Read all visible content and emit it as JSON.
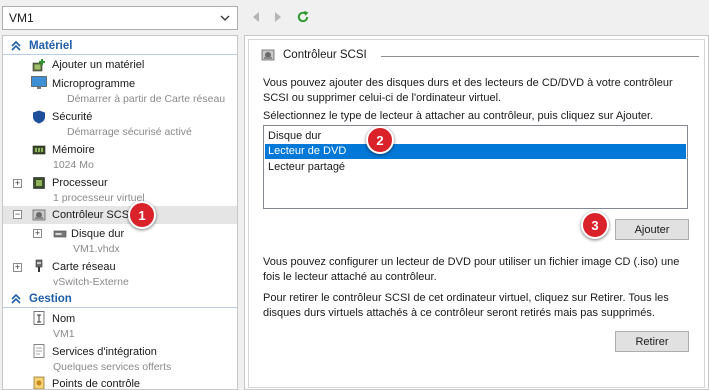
{
  "vm_selector": {
    "value": "VM1"
  },
  "sidebar": {
    "sections": {
      "hardware": {
        "label": "Matériel"
      },
      "management": {
        "label": "Gestion"
      }
    },
    "items": [
      {
        "label": "Ajouter un matériel",
        "sub": ""
      },
      {
        "label": "Microprogramme",
        "sub": "Démarrer à partir de Carte réseau"
      },
      {
        "label": "Sécurité",
        "sub": "Démarrage sécurisé activé"
      },
      {
        "label": "Mémoire",
        "sub": "1024 Mo"
      },
      {
        "label": "Processeur",
        "sub": "1 processeur virtuel"
      },
      {
        "label": "Contrôleur SCSI",
        "sub": ""
      },
      {
        "label": "Disque dur",
        "sub": "VM1.vhdx"
      },
      {
        "label": "Carte réseau",
        "sub": "vSwitch-Externe"
      },
      {
        "label": "Nom",
        "sub": "VM1"
      },
      {
        "label": "Services d'intégration",
        "sub": "Quelques services offerts"
      },
      {
        "label": "Points de contrôle",
        "sub": ""
      }
    ]
  },
  "panel": {
    "title": "Contrôleur SCSI",
    "intro": "Vous pouvez ajouter des disques durs et des lecteurs de CD/DVD à votre contrôleur SCSI ou supprimer celui-ci de l'ordinateur virtuel.",
    "instruction": "Sélectionnez le type de lecteur à attacher au contrôleur, puis cliquez sur Ajouter.",
    "drive_types": [
      "Disque dur",
      "Lecteur de DVD",
      "Lecteur partagé"
    ],
    "selected_drive_type": "Lecteur de DVD",
    "add_button": "Ajouter",
    "dvd_note": "Vous pouvez configurer un lecteur de DVD pour utiliser un fichier image CD (.iso) une fois le lecteur attaché au contrôleur.",
    "remove_note": "Pour retirer le contrôleur SCSI de cet ordinateur virtuel, cliquez sur Retirer. Tous les disques durs virtuels attachés à ce contrôleur seront retirés mais pas supprimés.",
    "remove_button": "Retirer"
  },
  "annotations": [
    "1",
    "2",
    "3"
  ],
  "colors": {
    "selection": "#0078d7",
    "section_header": "#1f5ea8",
    "badge": "#d9222a"
  }
}
